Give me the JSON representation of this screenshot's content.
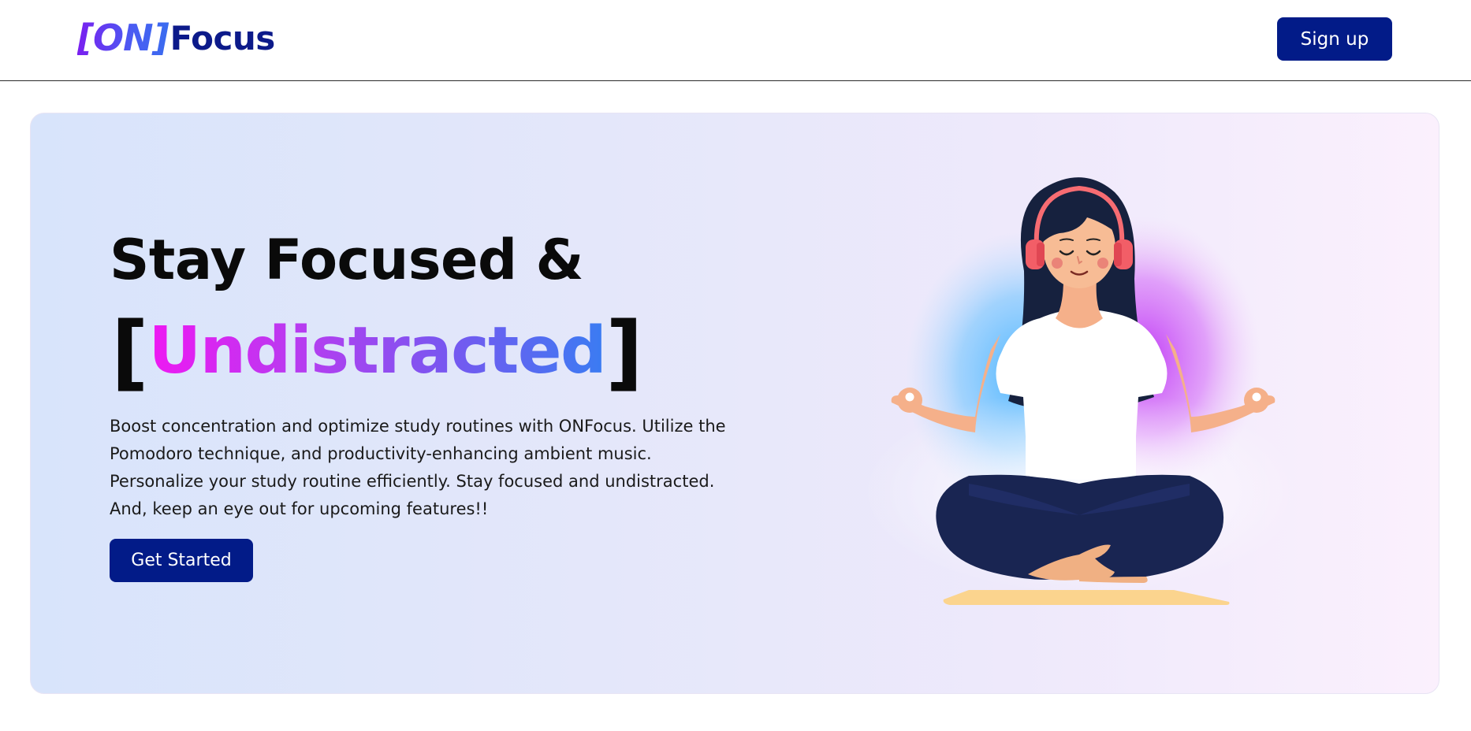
{
  "header": {
    "logo_on": "[ON]",
    "logo_focus": "Focus",
    "signup_label": "Sign up"
  },
  "hero": {
    "headline": "Stay Focused &",
    "bracket_open": "[",
    "highlight_word": "Undistracted",
    "bracket_close": "]",
    "description": "Boost concentration and optimize study routines with ONFocus. Utilize the Pomodoro technique, and productivity-enhancing ambient music. Personalize your study routine efficiently. Stay focused and undistracted. And, keep an eye out for upcoming features!!",
    "cta_label": "Get Started",
    "illustration": "meditating-woman-with-headphones"
  },
  "colors": {
    "brand_navy": "#021b88",
    "gradient_pink": "#ee18f2",
    "gradient_blue": "#3a7cf2",
    "hero_bg_left": "#d8e4fb",
    "hero_bg_right": "#fbf0fd"
  }
}
